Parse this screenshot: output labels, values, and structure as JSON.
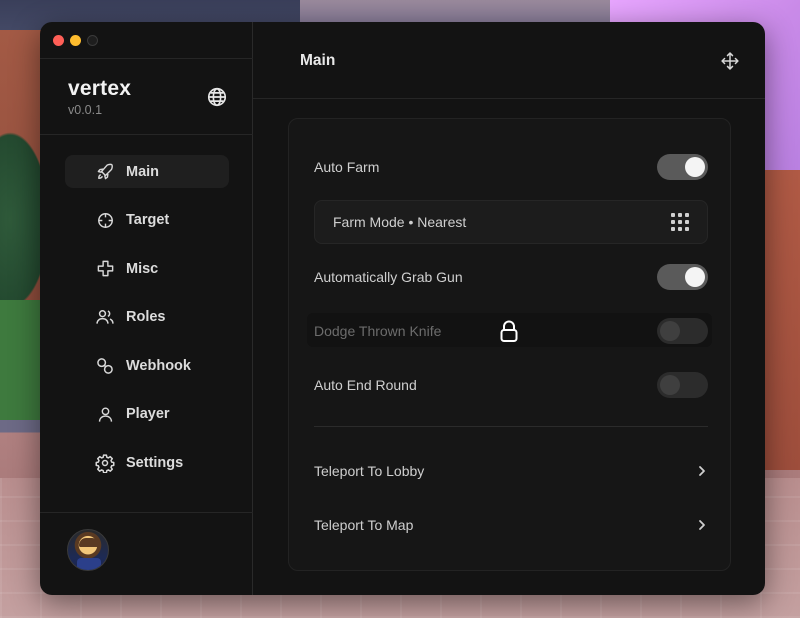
{
  "window": {
    "brand_name": "vertex",
    "version": "v0.0.1"
  },
  "sidebar": {
    "items": [
      {
        "label": "Main",
        "icon": "rocket-icon",
        "active": true
      },
      {
        "label": "Target",
        "icon": "crosshair-icon",
        "active": false
      },
      {
        "label": "Misc",
        "icon": "plus-icon",
        "active": false
      },
      {
        "label": "Roles",
        "icon": "users-icon",
        "active": false
      },
      {
        "label": "Webhook",
        "icon": "webhook-icon",
        "active": false
      },
      {
        "label": "Player",
        "icon": "user-icon",
        "active": false
      },
      {
        "label": "Settings",
        "icon": "gear-icon",
        "active": false
      }
    ]
  },
  "main": {
    "title": "Main",
    "options": {
      "auto_farm": {
        "label": "Auto Farm",
        "enabled": true
      },
      "farm_mode": {
        "label": "Farm Mode • Nearest"
      },
      "grab_gun": {
        "label": "Automatically Grab Gun",
        "enabled": true
      },
      "dodge_knife": {
        "label": "Dodge Thrown Knife",
        "enabled": false,
        "locked": true
      },
      "auto_end_round": {
        "label": "Auto End Round",
        "enabled": false
      }
    },
    "actions": {
      "teleport_lobby": {
        "label": "Teleport To Lobby"
      },
      "teleport_map": {
        "label": "Teleport To Map"
      }
    }
  },
  "colors": {
    "window_bg": "#131313",
    "toggle_on": "#5a5a5a",
    "toggle_off": "#2c2c2c",
    "close": "#ff5f57",
    "minimize": "#febc2e"
  }
}
